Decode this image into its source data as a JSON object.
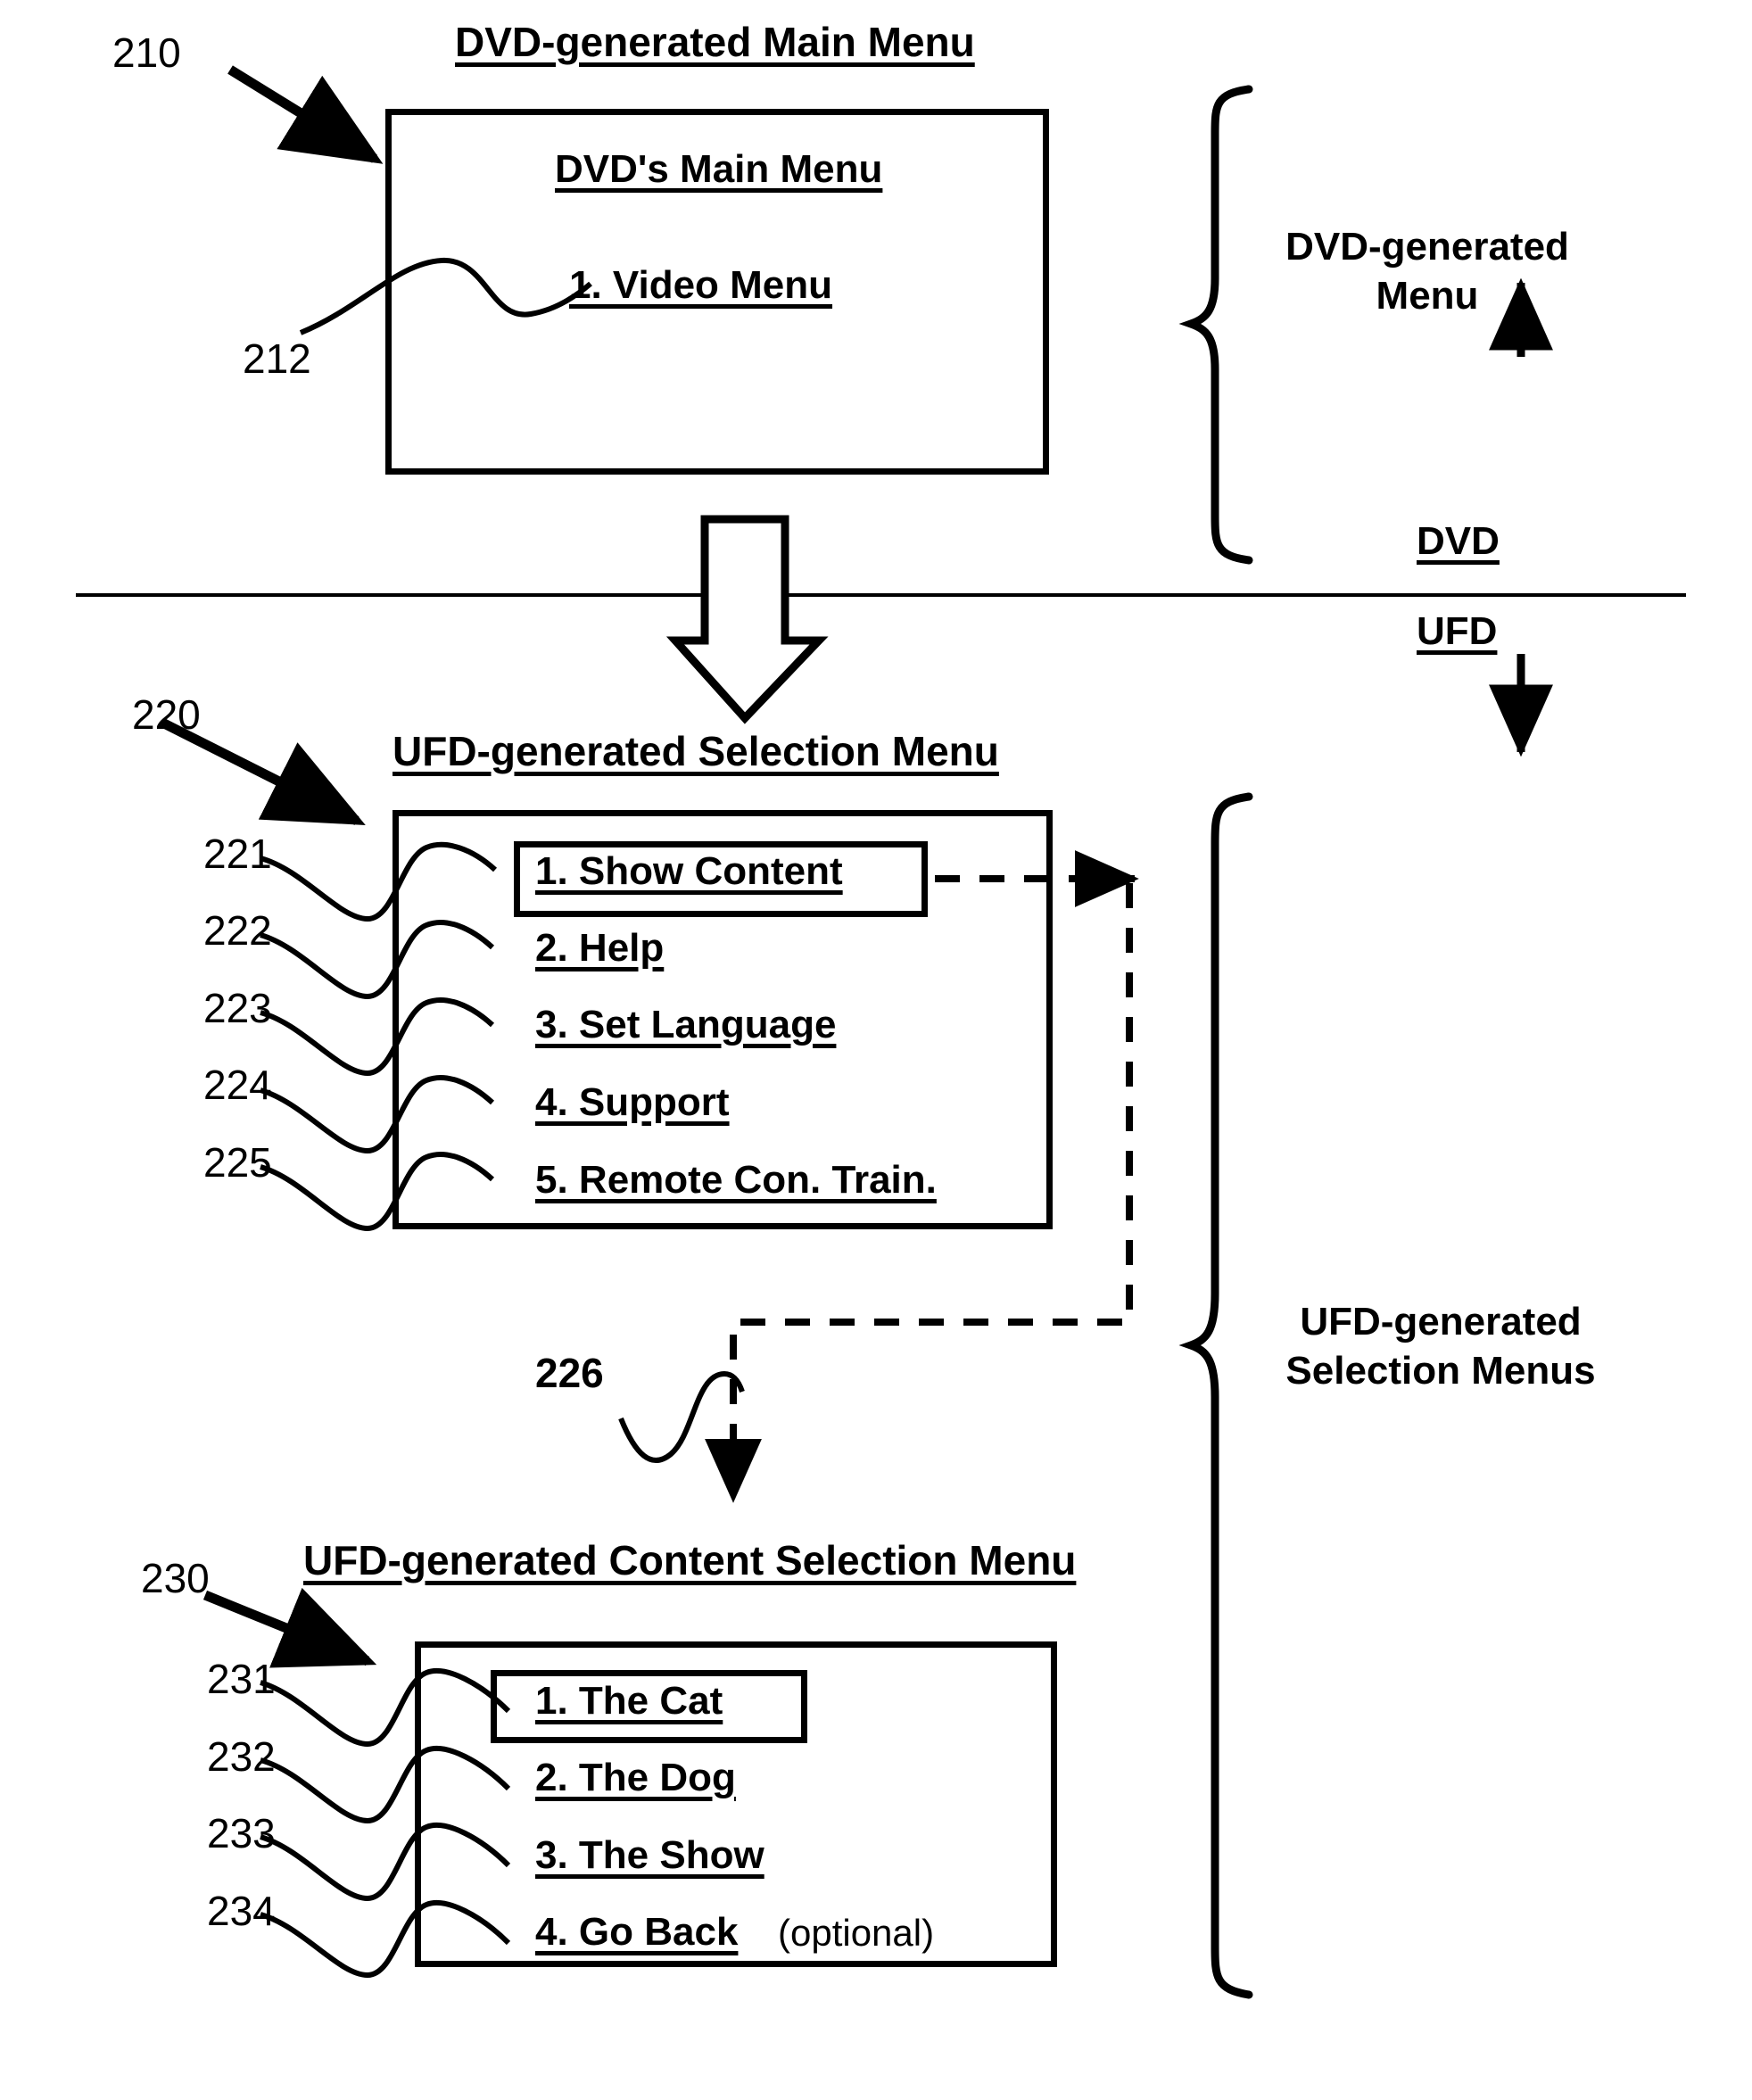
{
  "diagram": {
    "sections": {
      "dvd": {
        "title": "DVD-generated Main Menu",
        "ref": "210",
        "box_title": "DVD's Main Menu",
        "items": [
          {
            "ref": "212",
            "label": "1. Video Menu"
          }
        ],
        "brace_label": "DVD-generated Menu"
      },
      "divider": {
        "above_label": "DVD",
        "below_label": "UFD"
      },
      "ufd_selection": {
        "title": "UFD-generated Selection Menu",
        "ref": "220",
        "items": [
          {
            "ref": "221",
            "label": "1. Show Content",
            "highlighted": true
          },
          {
            "ref": "222",
            "label": "2. Help",
            "highlighted": false
          },
          {
            "ref": "223",
            "label": "3. Set Language",
            "highlighted": false
          },
          {
            "ref": "224",
            "label": "4. Support",
            "highlighted": false
          },
          {
            "ref": "225",
            "label": "5. Remote Con. Train.",
            "highlighted": false
          }
        ],
        "flow_ref": "226",
        "brace_label": "UFD-generated Selection Menus"
      },
      "ufd_content": {
        "title": "UFD-generated Content Selection Menu",
        "ref": "230",
        "items": [
          {
            "ref": "231",
            "label": "1. The Cat",
            "suffix": "",
            "highlighted": true
          },
          {
            "ref": "232",
            "label": "2. The Dog",
            "suffix": "",
            "highlighted": false
          },
          {
            "ref": "233",
            "label": "3. The Show",
            "suffix": "",
            "highlighted": false
          },
          {
            "ref": "234",
            "label": "4. Go Back",
            "suffix": "(optional)",
            "highlighted": false
          }
        ]
      }
    },
    "colors": {
      "ink": "#000000",
      "paper": "#ffffff"
    }
  }
}
